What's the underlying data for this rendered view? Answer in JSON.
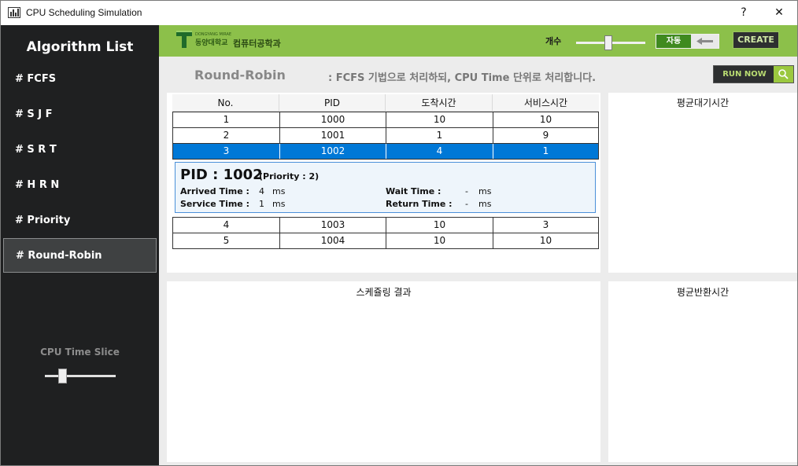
{
  "window": {
    "title": "CPU Scheduling Simulation",
    "help": "?",
    "close": "✕"
  },
  "sidebar": {
    "title": "Algorithm List",
    "items": [
      {
        "label": "# FCFS"
      },
      {
        "label": "# S J F"
      },
      {
        "label": "# S R T"
      },
      {
        "label": "# H R N"
      },
      {
        "label": "# Priority"
      },
      {
        "label": "# Round-Robin",
        "active": true
      }
    ],
    "slice_label": "CPU Time Slice"
  },
  "header": {
    "logo_sub": "DONGYANG MIRAE",
    "logo_school": "동양대학교",
    "logo_dept": "컴퓨터공학과",
    "count_label": "개수",
    "auto_label": "자동",
    "create_label": "CREATE"
  },
  "algo": {
    "name": "Round-Robin",
    "description": ":  FCFS 기법으로 처리하되, CPU Time 단위로 처리합니다.",
    "run_label": "RUN NOW"
  },
  "table": {
    "columns": [
      "No.",
      "PID",
      "도착시간",
      "서비스시간"
    ],
    "rows": [
      [
        "1",
        "1000",
        "10",
        "10"
      ],
      [
        "2",
        "1001",
        "1",
        "9"
      ],
      [
        "3",
        "1002",
        "4",
        "1"
      ],
      [
        "4",
        "1003",
        "10",
        "3"
      ],
      [
        "5",
        "1004",
        "10",
        "10"
      ]
    ],
    "selected_index": 2
  },
  "detail": {
    "pid_text": "PID : 1002",
    "priority_text": "(Priority :  2)",
    "arrived_label": "Arrived Time :",
    "arrived_value": "4",
    "service_label": "Service Time :",
    "service_value": "1",
    "wait_label": "Wait Time :",
    "wait_value": "-",
    "return_label": "Return Time :",
    "return_value": "-",
    "unit": "ms"
  },
  "panels": {
    "avg_wait": "평균대기시간",
    "result": "스케쥴링 결과",
    "avg_return": "평균반환시간"
  },
  "colors": {
    "accent_green": "#8cc04a",
    "selection_blue": "#0078d7",
    "sidebar_bg": "#1f2021"
  }
}
